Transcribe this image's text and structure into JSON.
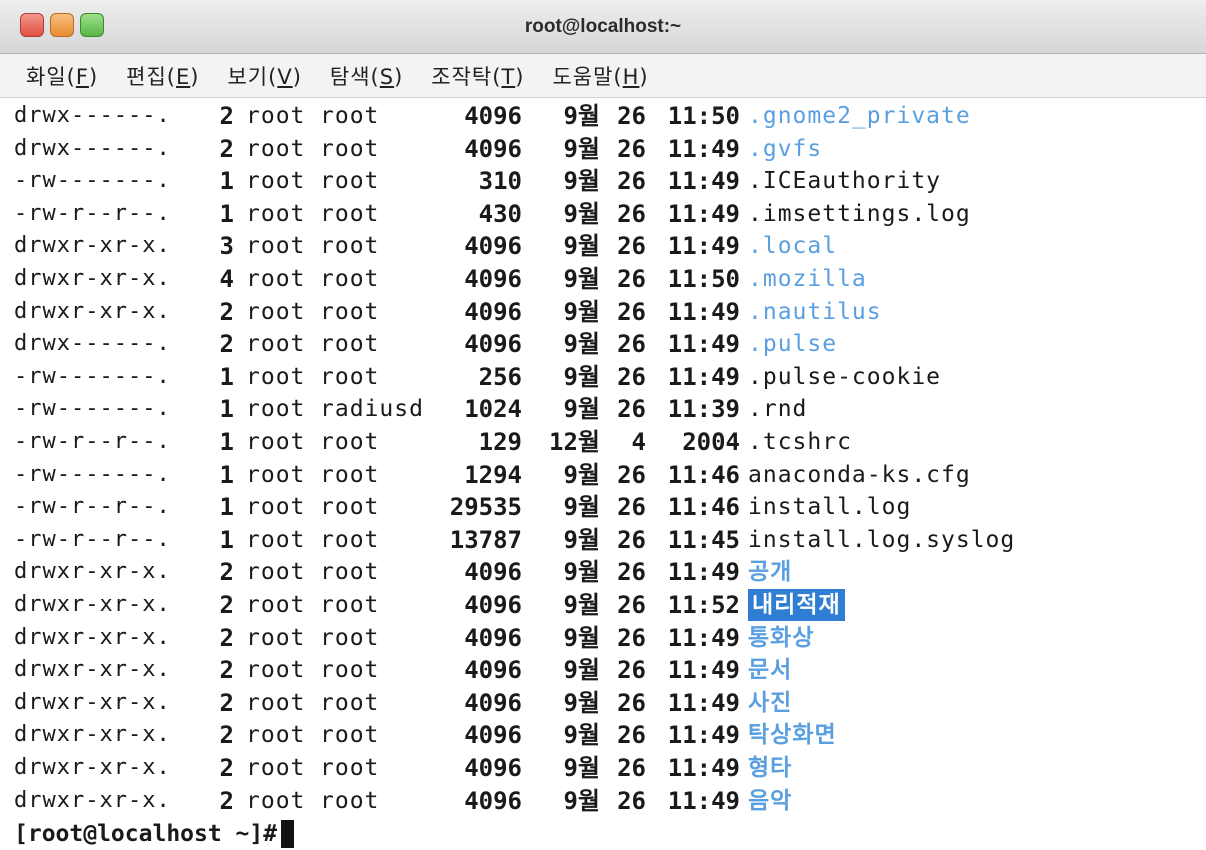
{
  "window": {
    "title": "root@localhost:~",
    "colors": {
      "close": "#df4f44",
      "minimize": "#e98c31",
      "maximize": "#58b644",
      "dir": "#5a9fe0",
      "selection": "#2f7ed3"
    }
  },
  "menu": [
    {
      "label": "화일(",
      "mnemonic": "F",
      "close": ")"
    },
    {
      "label": "편집(",
      "mnemonic": "E",
      "close": ")"
    },
    {
      "label": "보기(",
      "mnemonic": "V",
      "close": ")"
    },
    {
      "label": "탐색(",
      "mnemonic": "S",
      "close": ")"
    },
    {
      "label": "조작탁(",
      "mnemonic": "T",
      "close": ")"
    },
    {
      "label": "도움말(",
      "mnemonic": "H",
      "close": ")"
    }
  ],
  "listing": [
    {
      "perm": "drwx------.",
      "links": "2",
      "owner": "root",
      "group": "root",
      "size": "4096",
      "month": "9월",
      "day": "26",
      "time": "11:50",
      "name": ".gnome2_private",
      "type": "dir"
    },
    {
      "perm": "drwx------.",
      "links": "2",
      "owner": "root",
      "group": "root",
      "size": "4096",
      "month": "9월",
      "day": "26",
      "time": "11:49",
      "name": ".gvfs",
      "type": "dir"
    },
    {
      "perm": "-rw-------.",
      "links": "1",
      "owner": "root",
      "group": "root",
      "size": "310",
      "month": "9월",
      "day": "26",
      "time": "11:49",
      "name": ".ICEauthority",
      "type": "file"
    },
    {
      "perm": "-rw-r--r--.",
      "links": "1",
      "owner": "root",
      "group": "root",
      "size": "430",
      "month": "9월",
      "day": "26",
      "time": "11:49",
      "name": ".imsettings.log",
      "type": "file"
    },
    {
      "perm": "drwxr-xr-x.",
      "links": "3",
      "owner": "root",
      "group": "root",
      "size": "4096",
      "month": "9월",
      "day": "26",
      "time": "11:49",
      "name": ".local",
      "type": "dir"
    },
    {
      "perm": "drwxr-xr-x.",
      "links": "4",
      "owner": "root",
      "group": "root",
      "size": "4096",
      "month": "9월",
      "day": "26",
      "time": "11:50",
      "name": ".mozilla",
      "type": "dir"
    },
    {
      "perm": "drwxr-xr-x.",
      "links": "2",
      "owner": "root",
      "group": "root",
      "size": "4096",
      "month": "9월",
      "day": "26",
      "time": "11:49",
      "name": ".nautilus",
      "type": "dir"
    },
    {
      "perm": "drwx------.",
      "links": "2",
      "owner": "root",
      "group": "root",
      "size": "4096",
      "month": "9월",
      "day": "26",
      "time": "11:49",
      "name": ".pulse",
      "type": "dir"
    },
    {
      "perm": "-rw-------.",
      "links": "1",
      "owner": "root",
      "group": "root",
      "size": "256",
      "month": "9월",
      "day": "26",
      "time": "11:49",
      "name": ".pulse-cookie",
      "type": "file"
    },
    {
      "perm": "-rw-------.",
      "links": "1",
      "owner": "root",
      "group": "radiusd",
      "size": "1024",
      "month": "9월",
      "day": "26",
      "time": "11:39",
      "name": ".rnd",
      "type": "file"
    },
    {
      "perm": "-rw-r--r--.",
      "links": "1",
      "owner": "root",
      "group": "root",
      "size": "129",
      "month": "12월",
      "day": "4",
      "time": "2004",
      "name": ".tcshrc",
      "type": "file"
    },
    {
      "perm": "-rw-------.",
      "links": "1",
      "owner": "root",
      "group": "root",
      "size": "1294",
      "month": "9월",
      "day": "26",
      "time": "11:46",
      "name": "anaconda-ks.cfg",
      "type": "file"
    },
    {
      "perm": "-rw-r--r--.",
      "links": "1",
      "owner": "root",
      "group": "root",
      "size": "29535",
      "month": "9월",
      "day": "26",
      "time": "11:46",
      "name": "install.log",
      "type": "file"
    },
    {
      "perm": "-rw-r--r--.",
      "links": "1",
      "owner": "root",
      "group": "root",
      "size": "13787",
      "month": "9월",
      "day": "26",
      "time": "11:45",
      "name": "install.log.syslog",
      "type": "file"
    },
    {
      "perm": "drwxr-xr-x.",
      "links": "2",
      "owner": "root",
      "group": "root",
      "size": "4096",
      "month": "9월",
      "day": "26",
      "time": "11:49",
      "name": "공개",
      "type": "dir-kr"
    },
    {
      "perm": "drwxr-xr-x.",
      "links": "2",
      "owner": "root",
      "group": "root",
      "size": "4096",
      "month": "9월",
      "day": "26",
      "time": "11:52",
      "name": "내리적재",
      "type": "selected"
    },
    {
      "perm": "drwxr-xr-x.",
      "links": "2",
      "owner": "root",
      "group": "root",
      "size": "4096",
      "month": "9월",
      "day": "26",
      "time": "11:49",
      "name": "통화상",
      "type": "dir-kr"
    },
    {
      "perm": "drwxr-xr-x.",
      "links": "2",
      "owner": "root",
      "group": "root",
      "size": "4096",
      "month": "9월",
      "day": "26",
      "time": "11:49",
      "name": "문서",
      "type": "dir-kr"
    },
    {
      "perm": "drwxr-xr-x.",
      "links": "2",
      "owner": "root",
      "group": "root",
      "size": "4096",
      "month": "9월",
      "day": "26",
      "time": "11:49",
      "name": "사진",
      "type": "dir-kr"
    },
    {
      "perm": "drwxr-xr-x.",
      "links": "2",
      "owner": "root",
      "group": "root",
      "size": "4096",
      "month": "9월",
      "day": "26",
      "time": "11:49",
      "name": "탁상화면",
      "type": "dir-kr"
    },
    {
      "perm": "drwxr-xr-x.",
      "links": "2",
      "owner": "root",
      "group": "root",
      "size": "4096",
      "month": "9월",
      "day": "26",
      "time": "11:49",
      "name": "형타",
      "type": "dir-kr"
    },
    {
      "perm": "drwxr-xr-x.",
      "links": "2",
      "owner": "root",
      "group": "root",
      "size": "4096",
      "month": "9월",
      "day": "26",
      "time": "11:49",
      "name": "음악",
      "type": "dir-kr"
    }
  ],
  "prompt": "[root@localhost ~]#"
}
